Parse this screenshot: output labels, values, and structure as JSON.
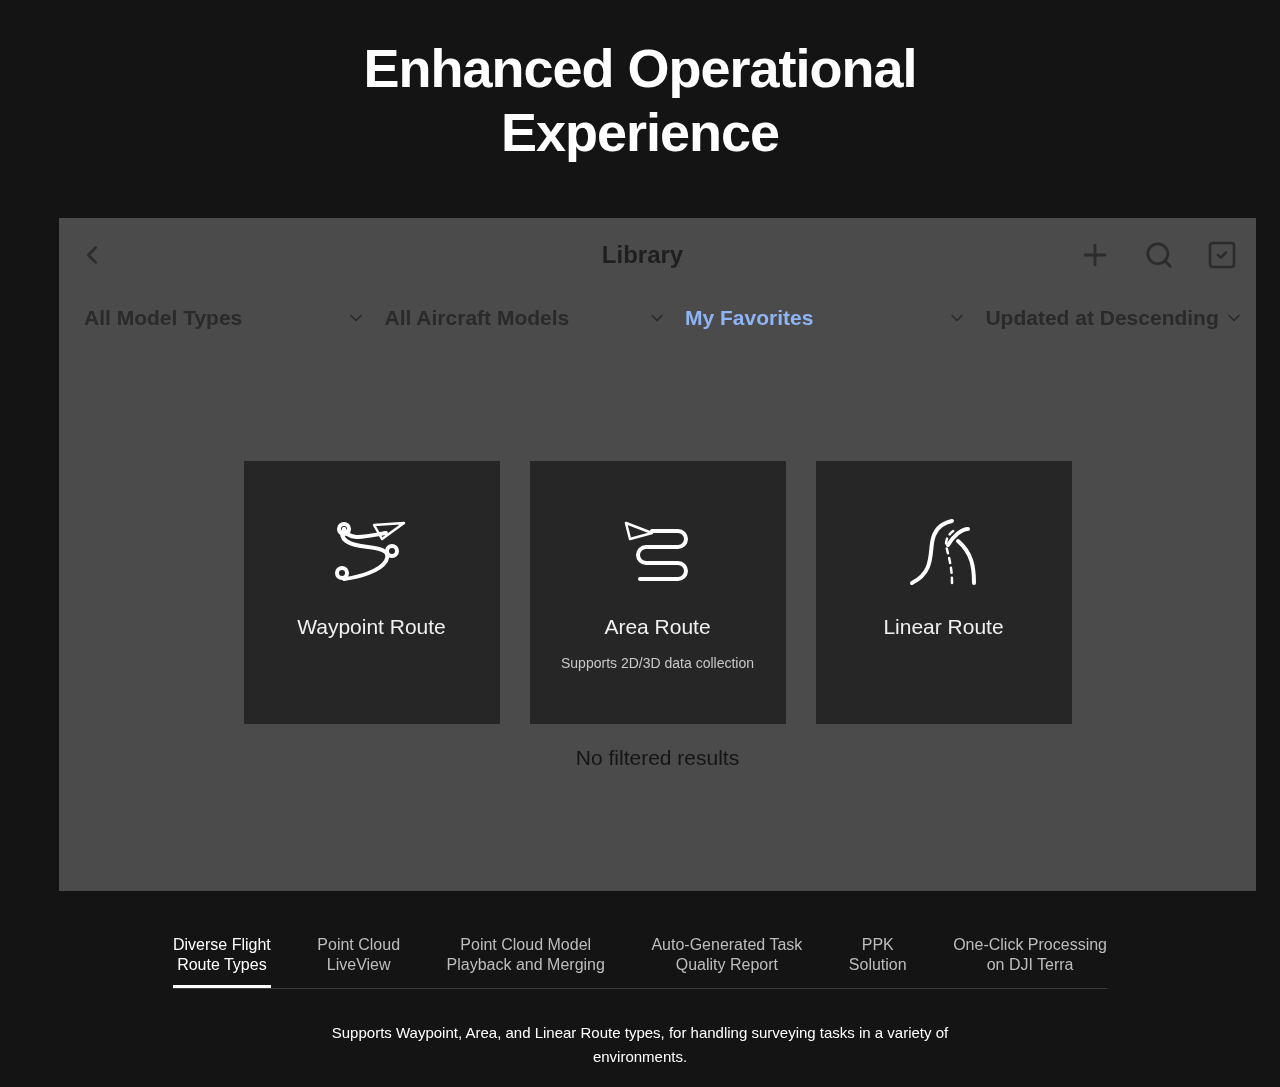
{
  "title": "Enhanced Operational Experience",
  "library": {
    "title": "Library",
    "filters": [
      {
        "label": "All Model Types",
        "selected": false
      },
      {
        "label": "All Aircraft Models",
        "selected": false
      },
      {
        "label": "My Favorites",
        "selected": true
      },
      {
        "label": "Updated at Descending",
        "selected": false
      }
    ],
    "cards": [
      {
        "kind": "waypoint",
        "title": "Waypoint Route"
      },
      {
        "kind": "area",
        "title": "Area Route",
        "subtitle": "Supports 2D/3D data collection"
      },
      {
        "kind": "linear",
        "title": "Linear Route"
      }
    ],
    "empty_text": "No filtered results"
  },
  "tabs": [
    {
      "label": "Diverse Flight\nRoute Types",
      "selected": true
    },
    {
      "label": "Point Cloud\nLiveView",
      "selected": false
    },
    {
      "label": "Point Cloud Model\nPlayback and Merging",
      "selected": false
    },
    {
      "label": "Auto-Generated Task\nQuality Report",
      "selected": false
    },
    {
      "label": "PPK\nSolution",
      "selected": false
    },
    {
      "label": "One-Click Processing\non DJI Terra",
      "selected": false
    }
  ],
  "description": "Supports Waypoint, Area, and Linear Route types, for handling surveying tasks in a variety of environments."
}
